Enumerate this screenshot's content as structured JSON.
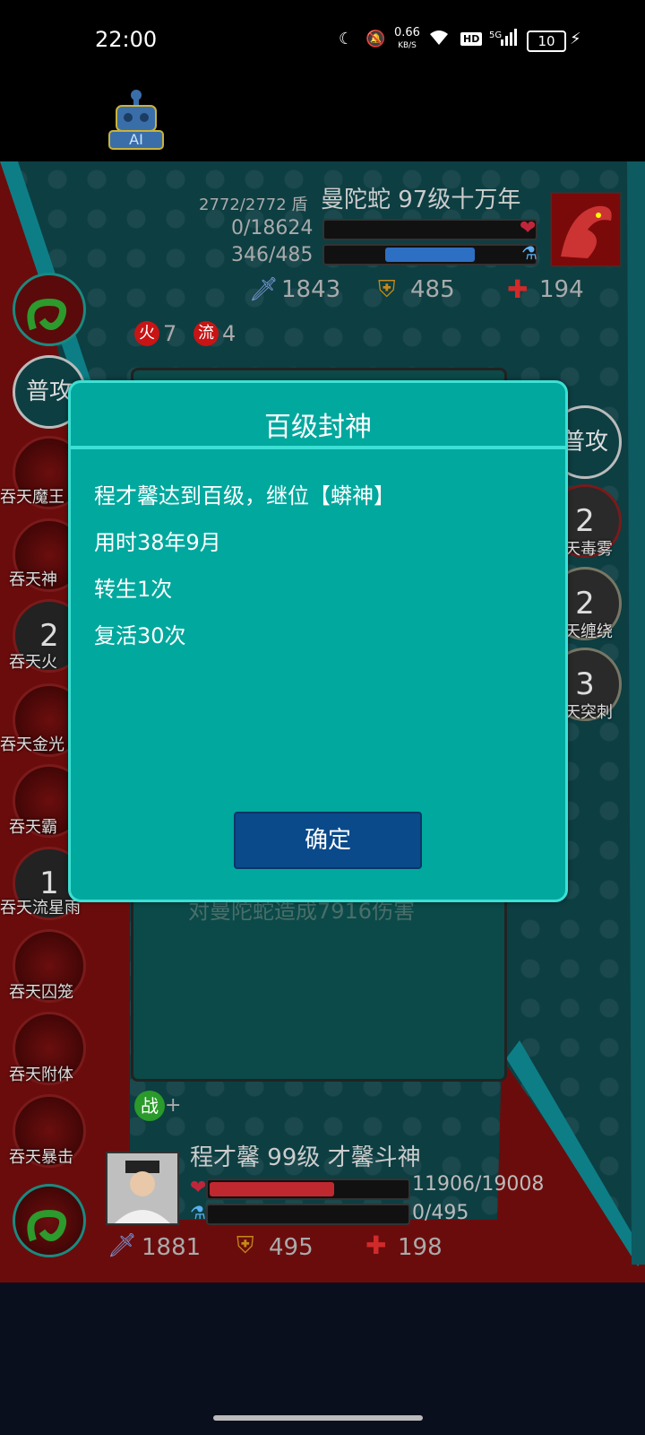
{
  "status_bar": {
    "time": "22:00",
    "net_speed": "0.66",
    "net_speed_unit": "KB/S",
    "hd": "HD",
    "signal": "5G",
    "battery": "10"
  },
  "ai_label": "AI",
  "enemy": {
    "shield_text": "2772/2772 盾",
    "name": "曼陀蛇 97级十万年",
    "hp_text": "0/18624",
    "mp_text": "346/485",
    "mp_fraction": 0.71,
    "attack": "1843",
    "defense": "485",
    "heal": "194",
    "buffs": [
      {
        "icon": "火",
        "value": "7"
      },
      {
        "icon": "流",
        "value": "4"
      }
    ]
  },
  "left_skills": [
    {
      "label": "",
      "num": ""
    },
    {
      "label": "普攻",
      "num": ""
    },
    {
      "label": "吞天魔王",
      "num": ""
    },
    {
      "label": "吞天神",
      "num": ""
    },
    {
      "label": "吞天火",
      "num": "2"
    },
    {
      "label": "吞天金光",
      "num": ""
    },
    {
      "label": "吞天霸",
      "num": ""
    },
    {
      "label": "吞天流星雨",
      "num": "1"
    },
    {
      "label": "吞天囚笼",
      "num": ""
    },
    {
      "label": "吞天附体",
      "num": ""
    },
    {
      "label": "吞天暴击",
      "num": ""
    }
  ],
  "right_skills": [
    {
      "label": "普攻",
      "num": ""
    },
    {
      "label": "天毒雾",
      "num": "2"
    },
    {
      "label": "天缠绕",
      "num": "2"
    },
    {
      "label": "天突刺",
      "num": "3"
    }
  ],
  "log_text": "对曼陀蛇造成7916伤害",
  "war_badge": "战",
  "war_plus": "+",
  "player": {
    "name": "程才馨 99级 才馨斗神",
    "hp_text": "11906/19008",
    "hp_fraction": 0.63,
    "mp_text": "0/495",
    "attack": "1881",
    "defense": "495",
    "heal": "198"
  },
  "dialog": {
    "title": "百级封神",
    "lines": [
      "程才馨达到百级，继位【蟒神】",
      "用时38年9月",
      "转生1次",
      "复活30次"
    ],
    "confirm": "确定"
  }
}
